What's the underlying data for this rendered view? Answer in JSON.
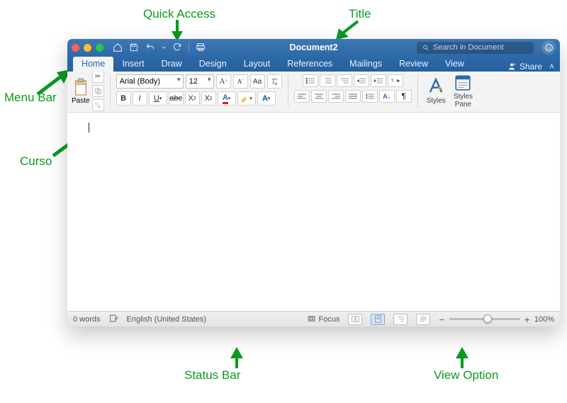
{
  "annotations": {
    "quick_access": "Quick Access",
    "title": "Title",
    "menu_bar": "Menu Bar",
    "cursor": "Curso",
    "status_bar": "Status Bar",
    "view_option": "View Option"
  },
  "titlebar": {
    "doc_title": "Document2",
    "search_placeholder": "Search in Document"
  },
  "tabs": {
    "items": [
      "Home",
      "Insert",
      "Draw",
      "Design",
      "Layout",
      "References",
      "Mailings",
      "Review",
      "View"
    ],
    "share": "Share"
  },
  "ribbon": {
    "paste": "Paste",
    "font_name": "Arial (Body)",
    "font_size": "12",
    "styles": "Styles",
    "styles_pane": "Styles\nPane"
  },
  "status": {
    "words": "0 words",
    "language": "English (United States)",
    "focus": "Focus",
    "zoom_pct": "100%"
  }
}
